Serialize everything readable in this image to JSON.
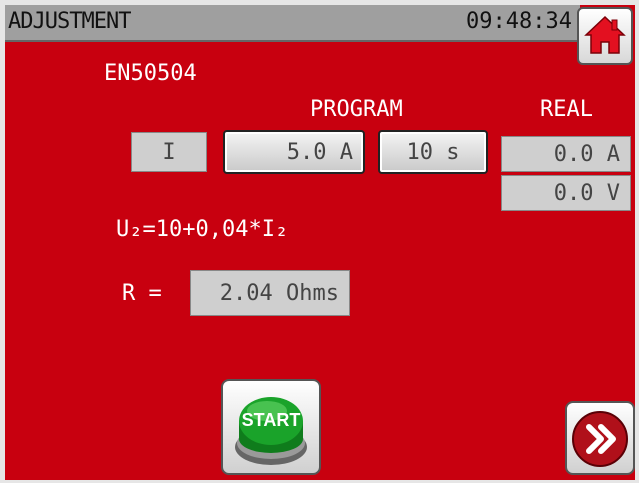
{
  "header": {
    "title": "ADJUSTMENT",
    "time": "09:48:34"
  },
  "standard": "EN50504",
  "labels": {
    "program": "PROGRAM",
    "real": "REAL"
  },
  "program": {
    "mode": "I",
    "current": "5.0 A",
    "time": "10 s"
  },
  "real": {
    "current": "0.0 A",
    "voltage": "0.0 V"
  },
  "formula": "U₂=10+0,04*I₂",
  "resistance": {
    "label": "R  =",
    "value": "2.04 Ohms"
  },
  "buttons": {
    "start": "START"
  },
  "icons": {
    "home": "home-icon",
    "start": "start-button-icon",
    "next": "double-chevron-right-icon"
  },
  "colors": {
    "background": "#c8000f",
    "header": "#9f9f9f",
    "start_green": "#1aa32a"
  }
}
